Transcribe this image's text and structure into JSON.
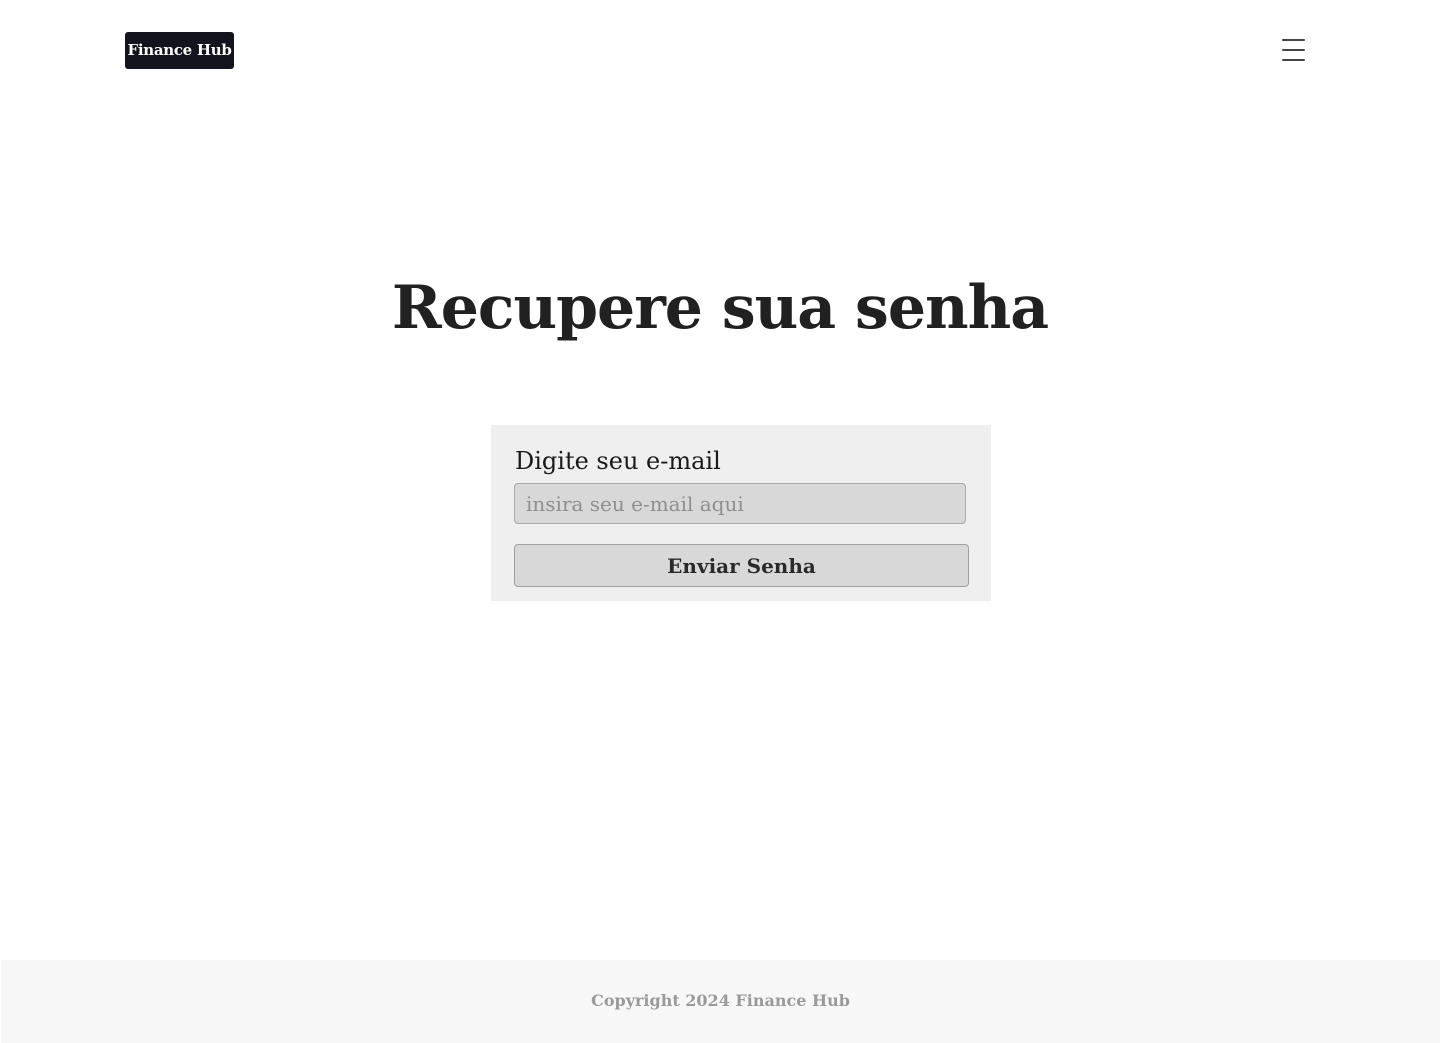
{
  "header": {
    "logo_text": "Finance Hub",
    "menu_icon": "hamburger-menu-icon"
  },
  "main": {
    "title": "Recupere sua senha",
    "form": {
      "email_label": "Digite seu e-mail",
      "email_value": "",
      "email_placeholder": "insira seu e-mail aqui",
      "submit_label": "Enviar Senha"
    }
  },
  "footer": {
    "copyright": "Copyright 2024 Finance Hub"
  },
  "colors": {
    "logo_background": "#14141f",
    "card_background": "#efefef",
    "input_background": "#d8d8d8",
    "footer_background": "#f7f7f7",
    "footer_text": "#9a9a9a"
  }
}
